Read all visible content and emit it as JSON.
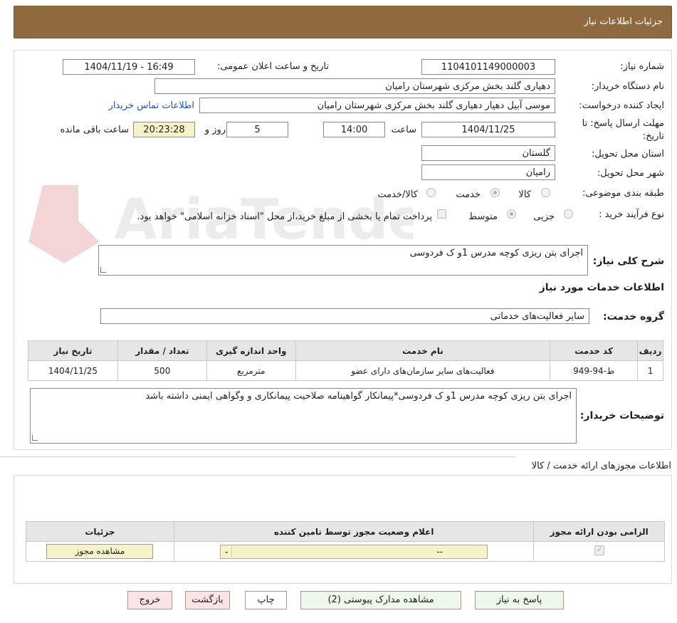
{
  "header": {
    "title": "جزئیات اطلاعات نیاز"
  },
  "form": {
    "need_number_label": "شماره نیاز:",
    "need_number": "1104101149000003",
    "announce_label": "تاریخ و ساعت اعلان عمومی:",
    "announce_value": "1404/11/19 - 16:49",
    "buyer_org_label": "نام دستگاه خریدار:",
    "buyer_org": "دهیاری گلند بخش مرکزی شهرستان رامیان",
    "creator_label": "ایجاد کننده درخواست:",
    "creator": "موسی آبیل دهیار دهیاری گلند بخش مرکزی شهرستان رامیان",
    "contact_link": "اطلاعات تماس خریدار",
    "deadline_label_1": "مهلت ارسال پاسخ: تا",
    "deadline_label_2": "تاریخ:",
    "deadline_date": "1404/11/25",
    "time_label": "ساعت",
    "deadline_time": "14:00",
    "days_value": "5",
    "days_label": "روز و",
    "remaining_time": "20:23:28",
    "remaining_label": "ساعت باقی مانده",
    "province_label": "استان محل تحویل:",
    "province": "گلستان",
    "city_label": "شهر محل تحویل:",
    "city": "رامیان",
    "category_label": "طبقه بندی موضوعی:",
    "category_options": [
      "کالا",
      "خدمت",
      "کالا/خدمت"
    ],
    "process_label": "نوع فرآیند خرید :",
    "process_options": [
      "جزیی",
      "متوسط"
    ],
    "payment_note": "پرداخت تمام یا بخشی از مبلغ خرید،از محل \"اسناد خزانه اسلامی\" خواهد بود."
  },
  "description": {
    "label": "شرح کلی نیاز:",
    "value": "اجرای بتن ریزی کوچه مدرس 1و ک فردوسی"
  },
  "services": {
    "section_title": "اطلاعات خدمات مورد نیاز",
    "group_label": "گروه خدمت:",
    "group_value": "سایر فعالیت‌های خدماتی",
    "columns": [
      "ردیف",
      "کد خدمت",
      "نام خدمت",
      "واحد اندازه گیری",
      "تعداد / مقدار",
      "تاریخ نیاز"
    ],
    "rows": [
      {
        "row": "1",
        "code": "ط-94-949",
        "name": "فعالیت‌های سایر سازمان‌های دارای عضو",
        "unit": "مترمربع",
        "qty": "500",
        "date": "1404/11/25"
      }
    ]
  },
  "buyer_notes": {
    "label": "توضیحات خریدار:",
    "value": "اجرای بتن ریزی کوچه مدرس 1و ک فردوسی*پیمانکار گواهینامه صلاحیت پیمانکاری و وگواهی ایمنی داشته باشد"
  },
  "permits": {
    "section_title": "اطلاعات مجوزهای ارائه خدمت / کالا",
    "columns": [
      "الزامی بودن ارائه مجوز",
      "اعلام وضعیت مجوز توسط تامین کننده",
      "جزئیات"
    ],
    "select_value": "--",
    "view_button": "مشاهده مجوز"
  },
  "buttons": {
    "reply": "پاسخ به نیاز",
    "attachments": "مشاهده مدارک پیوستی (2)",
    "print": "چاپ",
    "back": "بازگشت",
    "exit": "خروج"
  },
  "colors": {
    "header": "#8f6a3e",
    "highlight": "#f7f3c8",
    "exit_button": "#fde4e4",
    "action_button": "#e9f5e4"
  },
  "watermark": {
    "text": "AriaTender.neT"
  }
}
